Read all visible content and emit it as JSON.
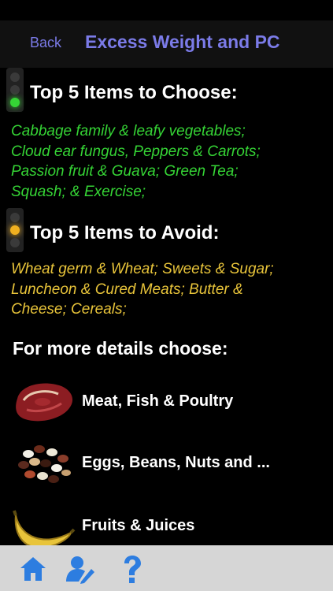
{
  "nav": {
    "back_label": "Back",
    "title": "Excess Weight and PC"
  },
  "choose": {
    "title": "Top 5 Items to Choose:",
    "lines": [
      "Cabbage family & leafy vegetables;",
      "Cloud ear fungus, Peppers & Carrots;",
      "Passion fruit & Guava; Green Tea;",
      "Squash; & Exercise;"
    ]
  },
  "avoid": {
    "title": "Top 5 Items to Avoid:",
    "lines": [
      "Wheat germ & Wheat; Sweets & Sugar;",
      "Luncheon & Cured Meats; Butter &",
      "Cheese; Cereals;"
    ]
  },
  "details": {
    "title": "For more details choose:",
    "items": [
      {
        "label": "Meat, Fish & Poultry",
        "icon": "meat-icon"
      },
      {
        "label": "Eggs, Beans, Nuts and ...",
        "icon": "beans-icon"
      },
      {
        "label": "Fruits & Juices",
        "icon": "banana-icon"
      }
    ]
  },
  "tabbar": {
    "items": [
      "home-icon",
      "edit-profile-icon",
      "help-icon"
    ]
  },
  "colors": {
    "accent": "#7b7be8",
    "choose_text": "#35d435",
    "avoid_text": "#e8c43a",
    "tab_icon": "#2d7de0"
  }
}
